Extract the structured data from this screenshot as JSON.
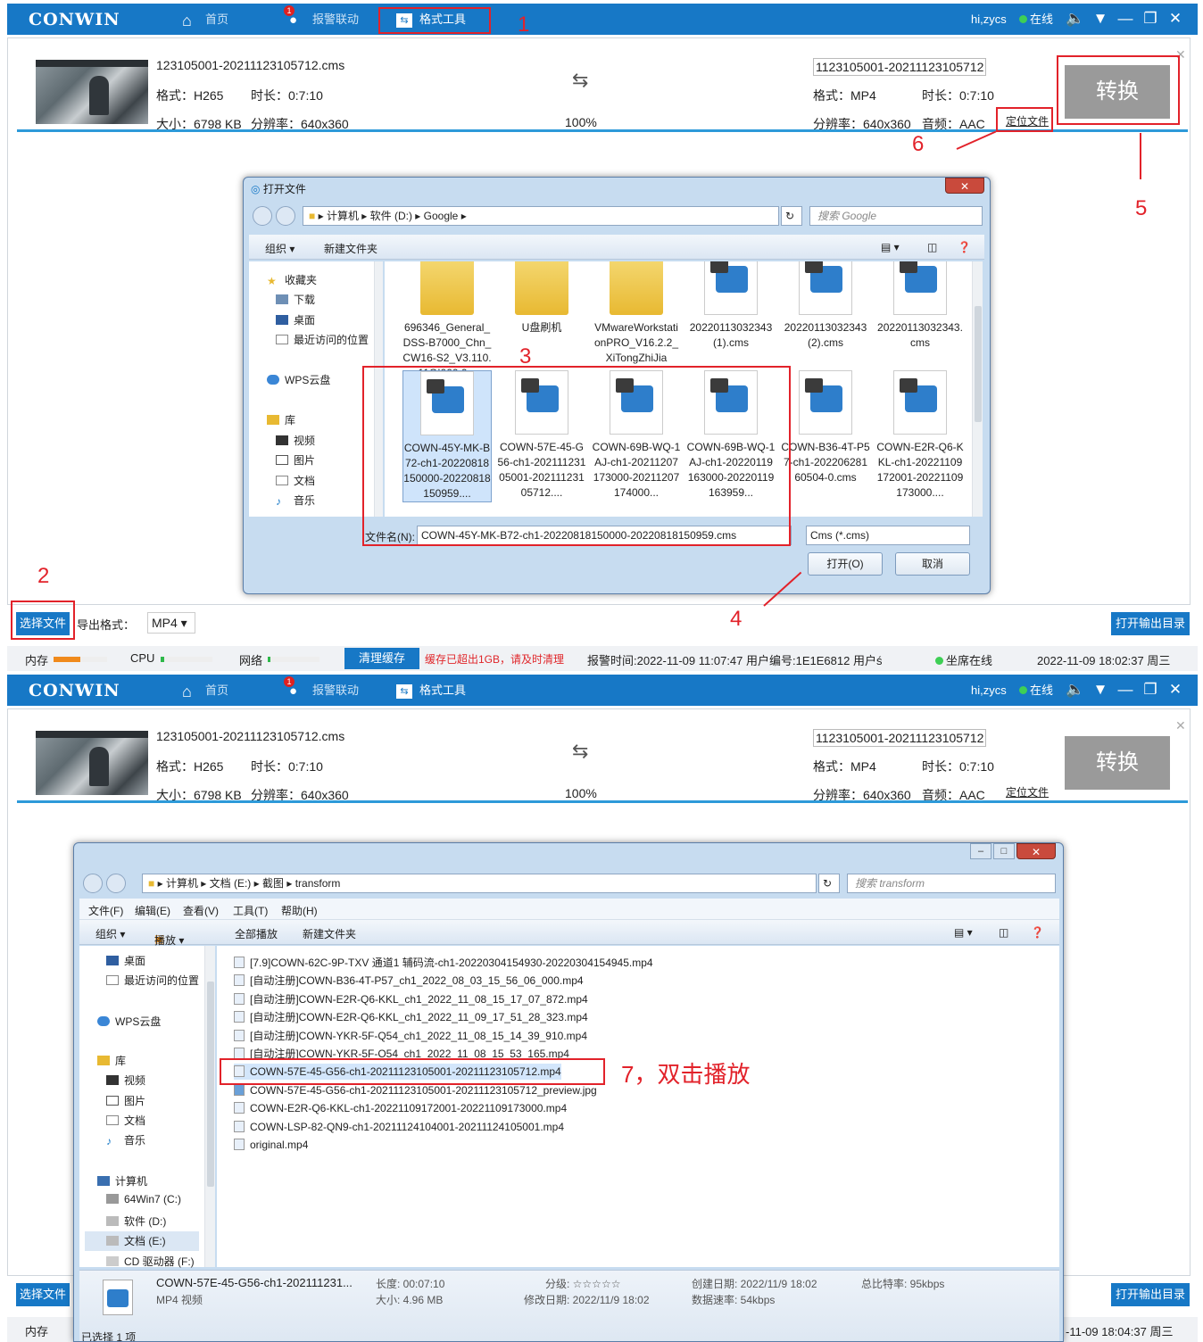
{
  "app": {
    "logo": "CONWIN",
    "nav": [
      "首页",
      "报警联动",
      "格式工具"
    ],
    "alarm_badge": "1",
    "user": "hi,zycs",
    "status": "在线"
  },
  "source": {
    "filename": "123105001-20211123105712.cms",
    "format": "格式：H265",
    "duration": "时长：0:7:10",
    "size": "大小：6798 KB",
    "resolution": "分辨率：640x360",
    "progress": "100%"
  },
  "output": {
    "filename": "1123105001-20211123105712",
    "format": "格式：MP4",
    "duration": "时长：0:7:10",
    "resolution": "分辨率：640x360",
    "audio": "音频：AAC",
    "locate_label": "定位文件",
    "convert_label": "转换"
  },
  "toolbar": {
    "select_file": "选择文件",
    "export_format_label": "导出格式：",
    "export_format": "MP4 ▾",
    "open_output_dir": "打开输出目录"
  },
  "statusbar": {
    "mem": "内存",
    "cpu": "CPU",
    "net": "网络",
    "clear_cache": "清理缓存",
    "warning": "缓存已超出1GB，请及时清理",
    "alarm_info": "报警时间:2022-11-09 11:07:47  用户编号:1E1E6812  用户ś",
    "seat_online": "坐席在线",
    "datetime1": "2022-11-09 18:02:37 周三",
    "datetime2_partial": "-11-09 18:04:37 周三"
  },
  "open_dialog": {
    "title": "打开文件",
    "breadcrumb": "▸ 计算机 ▸ 软件 (D:) ▸ Google ▸",
    "search_placeholder": "搜索 Google",
    "toolbar": [
      "组织 ▾",
      "新建文件夹"
    ],
    "nav": [
      "收藏夹",
      "下载",
      "桌面",
      "最近访问的位置",
      "WPS云盘",
      "库",
      "视频",
      "图片",
      "文档",
      "音乐"
    ],
    "row1": [
      "696346_General_DSS-B7000_Chn_CW16-S2_V3.110.11QI000.0...",
      "U盘刷机",
      "VMwareWorkstationPRO_V16.2.2_XiTongZhiJia",
      "20220113032343 (1).cms",
      "20220113032343 (2).cms",
      "20220113032343.cms"
    ],
    "row2": [
      "COWN-45Y-MK-B72-ch1-20220818150000-20220818150959....",
      "COWN-57E-45-G56-ch1-20211123105001-20211123105712....",
      "COWN-69B-WQ-1AJ-ch1-20211207173000-20211207174000...",
      "COWN-69B-WQ-1AJ-ch1-20220119163000-20220119163959...",
      "COWN-B36-4T-P57-ch1-20220628160504-0.cms",
      "COWN-E2R-Q6-KKL-ch1-20221109172001-20221109173000...."
    ],
    "filename_label": "文件名(N):",
    "filename_value": "COWN-45Y-MK-B72-ch1-20220818150000-20220818150959.cms",
    "filter": "Cms (*.cms)",
    "open_btn": "打开(O)",
    "cancel_btn": "取消"
  },
  "explorer": {
    "breadcrumb": "▸ 计算机 ▸ 文档 (E:) ▸ 截图 ▸ transform",
    "search_placeholder": "搜索 transform",
    "menu": [
      "文件(F)",
      "编辑(E)",
      "查看(V)",
      "工具(T)",
      "帮助(H)"
    ],
    "toolbar": [
      "组织 ▾",
      "播放 ▾",
      "全部播放",
      "新建文件夹"
    ],
    "nav": [
      "桌面",
      "最近访问的位置",
      "WPS云盘",
      "库",
      "视频",
      "图片",
      "文档",
      "音乐",
      "计算机",
      "64Win7  (C:)",
      "软件 (D:)",
      "文档 (E:)",
      "CD 驱动器 (F:)"
    ],
    "files": [
      "[7.9]COWN-62C-9P-TXV 通道1 辅码流-ch1-20220304154930-20220304154945.mp4",
      "[自动注册]COWN-B36-4T-P57_ch1_2022_08_03_15_56_06_000.mp4",
      "[自动注册]COWN-E2R-Q6-KKL_ch1_2022_11_08_15_17_07_872.mp4",
      "[自动注册]COWN-E2R-Q6-KKL_ch1_2022_11_09_17_51_28_323.mp4",
      "[自动注册]COWN-YKR-5F-Q54_ch1_2022_11_08_15_14_39_910.mp4",
      "[自动注册]COWN-YKR-5F-O54_ch1_2022_11_08_15_53_165.mp4",
      "COWN-57E-45-G56-ch1-20211123105001-20211123105712.mp4",
      "COWN-57E-45-G56-ch1-20211123105001-20211123105712_preview.jpg",
      "COWN-E2R-Q6-KKL-ch1-20221109172001-20221109173000.mp4",
      "COWN-LSP-82-QN9-ch1-20211124104001-20211124105001.mp4",
      "original.mp4"
    ],
    "details": {
      "name": "COWN-57E-45-G56-ch1-202111231...",
      "type": "MP4 视频",
      "length": "长度: 00:07:10",
      "size": "大小: 4.96 MB",
      "rating": "分级: ☆☆☆☆☆",
      "modified": "修改日期: 2022/11/9 18:02",
      "created": "创建日期: 2022/11/9 18:02",
      "datarate": "数据速率: 54kbps",
      "bitrate": "总比特率: 95kbps"
    },
    "selected_count": "已选择 1 项"
  },
  "annotations": [
    "1",
    "2",
    "3",
    "4",
    "5",
    "6",
    "7，双击播放"
  ],
  "colors": {
    "accent": "#1778c6",
    "annotation": "#e2222a",
    "highlight": "#2d9ad9"
  }
}
